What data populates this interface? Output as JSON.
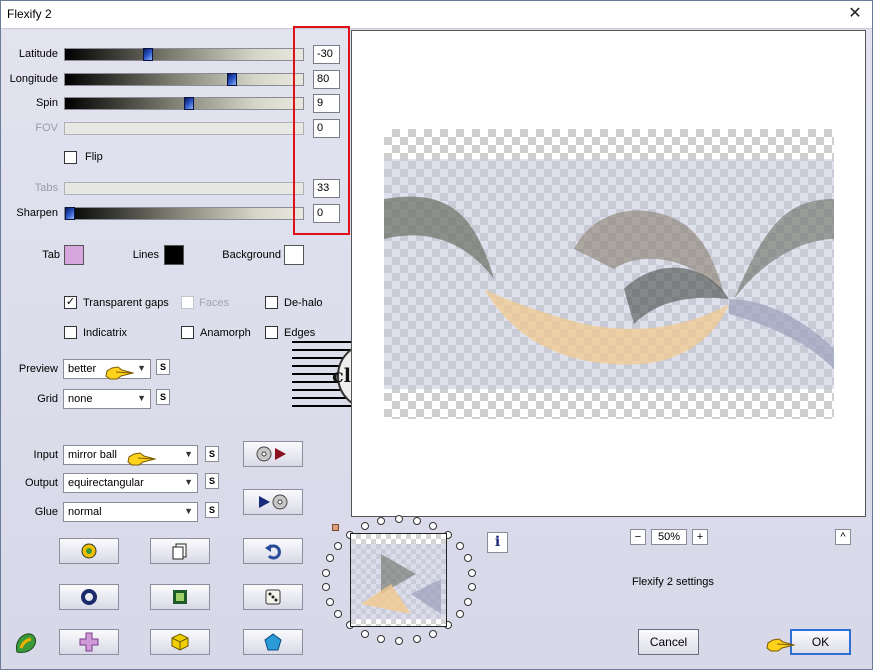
{
  "window": {
    "title": "Flexify 2",
    "close_glyph": "✕"
  },
  "sliders": [
    {
      "label": "Latitude",
      "value": "-30",
      "disabled": false,
      "thumb_pos": 0.34
    },
    {
      "label": "Longitude",
      "value": "80",
      "disabled": false,
      "thumb_pos": 0.71
    },
    {
      "label": "Spin",
      "value": "9",
      "disabled": false,
      "thumb_pos": 0.52
    },
    {
      "label": "FOV",
      "value": "0",
      "disabled": true,
      "thumb_pos": null
    },
    {
      "label": "Tabs",
      "value": "33",
      "disabled": true,
      "thumb_pos": null
    },
    {
      "label": "Sharpen",
      "value": "0",
      "disabled": false,
      "thumb_pos": 0.0
    }
  ],
  "flip": {
    "label": "Flip",
    "checked": false
  },
  "colors": {
    "tab": {
      "label": "Tab",
      "hex": "#d7a6df"
    },
    "lines": {
      "label": "Lines",
      "hex": "#000000"
    },
    "background": {
      "label": "Background",
      "hex": "#ffffff"
    }
  },
  "options": [
    {
      "label": "Transparent gaps",
      "checked": true,
      "disabled": false
    },
    {
      "label": "Faces",
      "checked": false,
      "disabled": true
    },
    {
      "label": "De-halo",
      "checked": false,
      "disabled": false
    },
    {
      "label": "Indicatrix",
      "checked": false,
      "disabled": false
    },
    {
      "label": "Anamorph",
      "checked": false,
      "disabled": false
    },
    {
      "label": "Edges",
      "checked": false,
      "disabled": false
    }
  ],
  "dropdowns": {
    "preview": {
      "label": "Preview",
      "value": "better"
    },
    "grid": {
      "label": "Grid",
      "value": "none"
    },
    "input": {
      "label": "Input",
      "value": "mirror ball"
    },
    "output": {
      "label": "Output",
      "value": "equirectangular"
    },
    "glue": {
      "label": "Glue",
      "value": "normal"
    }
  },
  "s_button_label": "S",
  "zoom": {
    "minus": "−",
    "value": "50%",
    "plus": "+",
    "collapse": "^"
  },
  "info_glyph": "i",
  "settings_label": "Flexify 2 settings",
  "buttons": {
    "cancel": "Cancel",
    "ok": "OK"
  },
  "watermark": "claudia"
}
